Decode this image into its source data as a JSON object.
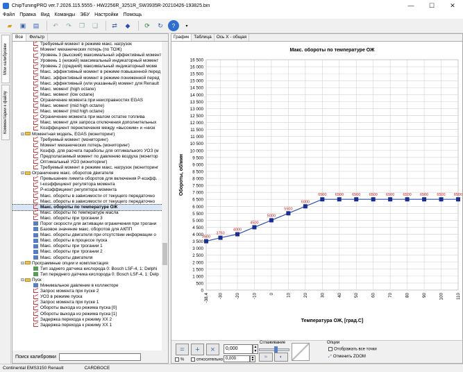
{
  "window": {
    "title": "ChipTuningPRO ver.7.2026.115.5555 - HW2256R_3251R_SW3935R-20210426-193825.bin",
    "minimize": "—",
    "maximize": "☐",
    "close": "✕"
  },
  "menu": [
    "Файл",
    "Правка",
    "Вид",
    "Команды",
    "ЭБУ",
    "Настройки",
    "Помощь"
  ],
  "left_vtabs": [
    "Мои калибровки",
    "Комментарии к файлу"
  ],
  "tree_tabs": [
    "Все",
    "Фильтр"
  ],
  "tree": [
    {
      "type": "c",
      "indent": 2,
      "label": "Требуемый момент в режиме макс. нагрузок"
    },
    {
      "type": "c",
      "indent": 2,
      "label": "Момент механических потерь (по ТОЖ)"
    },
    {
      "type": "c",
      "indent": 2,
      "label": "Уровень 3 (высокий) максимальный эффективный момент"
    },
    {
      "type": "c",
      "indent": 2,
      "label": "Уровень 1 (низкий) максимальный индикаторный момент"
    },
    {
      "type": "c",
      "indent": 2,
      "label": "Уровень 2 (средний) максимальный индикаторный моме"
    },
    {
      "type": "c",
      "indent": 2,
      "label": "Макс. эффективный момент в режиме повышенной перед"
    },
    {
      "type": "c",
      "indent": 2,
      "label": "Макс. эффективный момент в режиме пониженной перед"
    },
    {
      "type": "c",
      "indent": 2,
      "label": "Макс. эффективный (или указанный) момент для Renault"
    },
    {
      "type": "c",
      "indent": 2,
      "label": "Макс. момент (high octane)"
    },
    {
      "type": "c",
      "indent": 2,
      "label": "Макс. момент (low octane)"
    },
    {
      "type": "c",
      "indent": 2,
      "label": "Ограничение момента при неисправностях EGAS"
    },
    {
      "type": "c",
      "indent": 2,
      "label": "Макс. момент (mid high octane)"
    },
    {
      "type": "c",
      "indent": 2,
      "label": "Макс. момент (mid high octane)"
    },
    {
      "type": "c",
      "indent": 2,
      "label": "Ограничение момента при малом остатке топлива"
    },
    {
      "type": "c",
      "indent": 2,
      "label": "Макс. момент для запроса отключения дополнительных"
    },
    {
      "type": "c",
      "indent": 2,
      "label": "Коэффициент переключения между «высоким» и «низк"
    },
    {
      "type": "f",
      "indent": 1,
      "exp": "⊟",
      "label": "Моментная модель, EGAS (мониторинг)"
    },
    {
      "type": "c",
      "indent": 2,
      "label": "Требуемый момент (мониторинг)"
    },
    {
      "type": "c",
      "indent": 2,
      "label": "Момент механических потерь (мониторинг)"
    },
    {
      "type": "c",
      "indent": 2,
      "label": "Коэфф. для расчета параболы для оптимального УОЗ (м"
    },
    {
      "type": "c",
      "indent": 2,
      "label": "Предполагаемый момент по давлению воздуха (монитор"
    },
    {
      "type": "c",
      "indent": 2,
      "label": "Оптимальный УОЗ (мониторинг)"
    },
    {
      "type": "c",
      "indent": 2,
      "label": "Требуемый момент в режиме макс. нагрузок (мониторинг"
    },
    {
      "type": "f",
      "indent": 1,
      "exp": "⊟",
      "label": "Ограничение макс. оборотов двигателя"
    },
    {
      "type": "c",
      "indent": 2,
      "label": "Превышение лимита оборотов для включения P-коэфф."
    },
    {
      "type": "c",
      "indent": 2,
      "label": "I-коэффициент регулятора момента"
    },
    {
      "type": "c",
      "indent": 2,
      "label": "P-коэффициент регулятора момента"
    },
    {
      "type": "c",
      "indent": 2,
      "label": "Макс. обороты  в зависимости от текущего передаточно"
    },
    {
      "type": "c",
      "indent": 2,
      "label": "Макс. обороты  в зависимости от текущего передаточно"
    },
    {
      "type": "c",
      "indent": 2,
      "label": "Макс. обороты по температуре ОЖ",
      "selected": true
    },
    {
      "type": "c",
      "indent": 2,
      "label": "Макс. обороты по температуре масла"
    },
    {
      "type": "c",
      "indent": 2,
      "label": "Макс. обороты при трогании 3"
    },
    {
      "type": "d",
      "indent": 2,
      "label": "Порог скорости для активации ограничения при трогани"
    },
    {
      "type": "d",
      "indent": 2,
      "label": "Базовое значение макс. оборотов для АКПП"
    },
    {
      "type": "d",
      "indent": 2,
      "label": "Макс. обороты двигателя при отсутствии  информации о"
    },
    {
      "type": "d",
      "indent": 2,
      "label": "Макс. обороты в процессе пуска"
    },
    {
      "type": "d",
      "indent": 2,
      "label": "Макс. обороты при трогании 1"
    },
    {
      "type": "d",
      "indent": 2,
      "label": "Макс. обороты при трогании 2"
    },
    {
      "type": "d",
      "indent": 2,
      "label": "Макс. обороты двигателя"
    },
    {
      "type": "f",
      "indent": 1,
      "exp": "⊟",
      "label": "Программные опции и комплектация"
    },
    {
      "type": "t",
      "indent": 2,
      "label": "Тип заднего датчика кислорода 0: Bosch LSF-4, 1: Delphi"
    },
    {
      "type": "t",
      "indent": 2,
      "label": "Тип переднего датчика кислорода 0: Bosch LSF-4, 1: Delp"
    },
    {
      "type": "f",
      "indent": 1,
      "exp": "⊟",
      "label": "Пуск"
    },
    {
      "type": "d",
      "indent": 2,
      "label": "Минимальное давление в коллекторе"
    },
    {
      "type": "c",
      "indent": 2,
      "label": "Запрос момента при пуске 2"
    },
    {
      "type": "c",
      "indent": 2,
      "label": "УОЗ в режиме пуска"
    },
    {
      "type": "c",
      "indent": 2,
      "label": "Запрос момента при пуске 1"
    },
    {
      "type": "c",
      "indent": 2,
      "label": "Обороты выхода из режима пуска [0]"
    },
    {
      "type": "c",
      "indent": 2,
      "label": "Обороты выхода из режима пуска [1]"
    },
    {
      "type": "c",
      "indent": 2,
      "label": "Задержка перехода к режиму ХХ 2"
    },
    {
      "type": "c",
      "indent": 2,
      "label": "Задержка перехода к режиму ХХ 1"
    }
  ],
  "search": {
    "label": "Поиск калибровки",
    "value": ""
  },
  "chart_tabs": [
    "График",
    "Таблица",
    "Ось X - общая"
  ],
  "bottom": {
    "value1": "0,000",
    "value2": "0,000",
    "pct_label": "%",
    "relative_label": "относительно",
    "smoothing_label": "Сглаживание",
    "options_label": "Опции",
    "show_all_points": "Отображать все точки",
    "cancel_zoom": "Отменить ZOOM"
  },
  "status": {
    "ecu": "Continental EMS3150 Renault",
    "cal": "CARDBOCE"
  },
  "chart_data": {
    "type": "line",
    "title": "Макс. обороты по температуре ОЖ",
    "xlabel": "Температура ОЖ, [град.С]",
    "ylabel": "Обороты, об/мин",
    "ylim": [
      0,
      16500
    ],
    "yticks": [
      0,
      500,
      1000,
      1500,
      2000,
      2500,
      3000,
      3500,
      4000,
      4500,
      5000,
      5500,
      6000,
      6500,
      7000,
      7500,
      8000,
      8500,
      9000,
      9500,
      10000,
      10500,
      11000,
      11500,
      12000,
      12500,
      13000,
      13500,
      14000,
      14500,
      15000,
      15500,
      16000,
      16500
    ],
    "x": [
      -38.4,
      -30,
      -20,
      -10,
      0,
      10,
      20,
      30,
      40,
      50,
      60,
      70,
      80,
      90,
      100,
      110
    ],
    "x_labels": [
      "-38,4",
      "-30",
      "-20",
      "-10",
      "0",
      "10",
      "20",
      "30",
      "40",
      "50",
      "60",
      "70",
      "80",
      "90",
      "100",
      "110"
    ],
    "values": [
      3500,
      3750,
      4000,
      4500,
      5000,
      5500,
      6000,
      6500,
      6500,
      6500,
      6500,
      6500,
      6500,
      6500,
      6500,
      6500
    ],
    "point_labels": [
      "3500",
      "3750",
      "4000",
      "4500",
      "5000",
      "5500",
      "6000",
      "6500",
      "6500",
      "6500",
      "6500",
      "6500",
      "6500",
      "6500",
      "6500",
      "6500"
    ],
    "line_color": "#2b4fb5",
    "marker_color": "#1a2e8f",
    "label_color": "#c02020",
    "grid": true
  }
}
